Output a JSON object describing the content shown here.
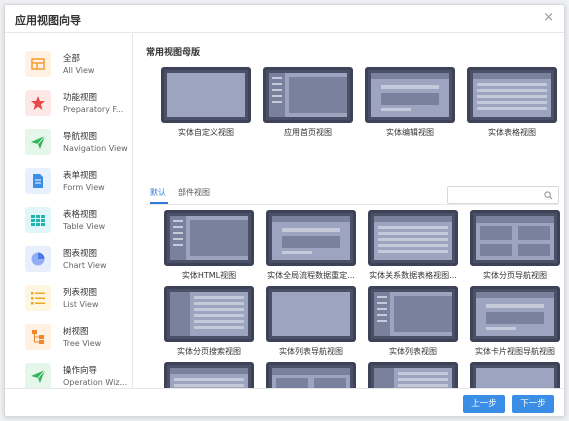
{
  "dialog": {
    "title": "应用视图向导",
    "close_symbol": "×"
  },
  "sidebar": {
    "items": [
      {
        "cn": "全部",
        "en": "All View",
        "icon": "grid-icon",
        "bg": "#fff2e2",
        "fg": "#f5a03a"
      },
      {
        "cn": "功能视图",
        "en": "Preparatory F...",
        "icon": "star-icon",
        "bg": "#fde8e8",
        "fg": "#e84a4a"
      },
      {
        "cn": "导航视图",
        "en": "Navigation View",
        "icon": "paper-plane-icon",
        "bg": "#e6f6ea",
        "fg": "#2fb55a"
      },
      {
        "cn": "表单视图",
        "en": "Form View",
        "icon": "document-icon",
        "bg": "#e6f1fd",
        "fg": "#3a8ee6"
      },
      {
        "cn": "表格视图",
        "en": "Table View",
        "icon": "table-icon",
        "bg": "#e1f6f6",
        "fg": "#22b5b0"
      },
      {
        "cn": "图表视图",
        "en": "Chart View",
        "icon": "pie-chart-icon",
        "bg": "#e8eefc",
        "fg": "#4a78e8"
      },
      {
        "cn": "列表视图",
        "en": "List View",
        "icon": "list-icon",
        "bg": "#fff6e0",
        "fg": "#f0a524"
      },
      {
        "cn": "树视图",
        "en": "Tree View",
        "icon": "tree-icon",
        "bg": "#fff0e2",
        "fg": "#f0862a"
      },
      {
        "cn": "操作向导",
        "en": "Operation Wiz...",
        "icon": "paper-plane-icon",
        "bg": "#e6f6ea",
        "fg": "#2fb55a"
      }
    ]
  },
  "main": {
    "common_title": "常用视图母版",
    "common_templates": [
      {
        "label": "实体自定义视图"
      },
      {
        "label": "应用首页视图"
      },
      {
        "label": "实体编辑视图"
      },
      {
        "label": "实体表格视图"
      }
    ],
    "tabs": [
      {
        "label": "默认",
        "active": true
      },
      {
        "label": "部件视图",
        "active": false
      }
    ],
    "search": {
      "placeholder": "",
      "value": ""
    },
    "templates": [
      {
        "label": "实体HTML视图"
      },
      {
        "label": "实体全局流程数据重定..."
      },
      {
        "label": "实体关系数据表格视图..."
      },
      {
        "label": "实体分页导航视图"
      },
      {
        "label": "实体分页搜索视图"
      },
      {
        "label": "实体列表导航视图"
      },
      {
        "label": "实体列表视图"
      },
      {
        "label": "实体卡片视图导航视图"
      }
    ]
  },
  "footer": {
    "prev_label": "上一步",
    "next_label": "下一步"
  },
  "colors": {
    "accent": "#3a8ee6",
    "thumb_frame": "#3d4257",
    "thumb_screen": "#9da4bf"
  }
}
